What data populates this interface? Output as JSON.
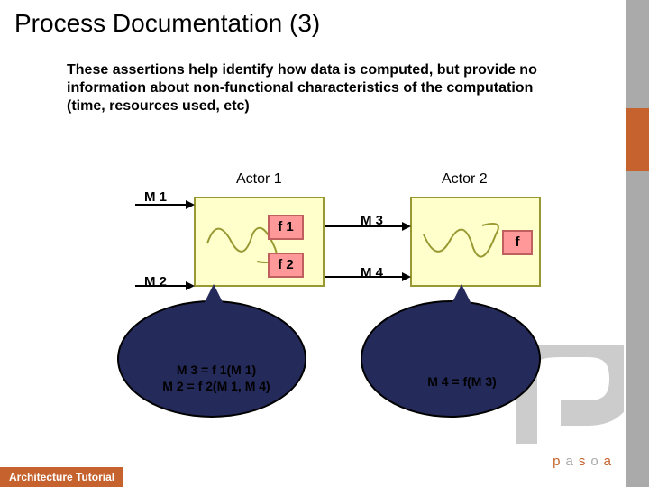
{
  "title": "Process Documentation (3)",
  "description": "These assertions help identify how data is computed, but provide no information about non-functional characteristics of the computation\n(time, resources used, etc)",
  "actor1": {
    "label": "Actor 1"
  },
  "actor2": {
    "label": "Actor 2"
  },
  "messages": {
    "m1": "M 1",
    "m2": "M 2",
    "m3": "M 3",
    "m4": "M 4"
  },
  "functions": {
    "f1": "f 1",
    "f2": "f 2",
    "f": "f"
  },
  "callout_left": {
    "line1": "M 3 = f 1(M 1)",
    "line2": "M 2 = f 2(M 1, M 4)"
  },
  "callout_right": {
    "line1": "M 4 = f(M 3)"
  },
  "footer": "Architecture Tutorial",
  "brand": {
    "p": "p",
    "a": "a",
    "s": "s",
    "o": "o",
    "a2": "a"
  }
}
